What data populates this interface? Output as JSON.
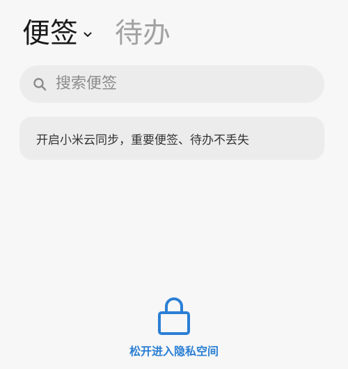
{
  "header": {
    "tab_notes_label": "便签",
    "tab_todo_label": "待办"
  },
  "search": {
    "placeholder": "搜索便签",
    "icon": "search-icon"
  },
  "banner": {
    "text": "开启小米云同步，重要便签、待办不丢失"
  },
  "private_space": {
    "label": "松开进入隐私空间",
    "icon": "lock-icon"
  },
  "colors": {
    "background": "#f7f7f7",
    "accent": "#2a7fd4",
    "inactive_tab": "#a2a2a2"
  }
}
